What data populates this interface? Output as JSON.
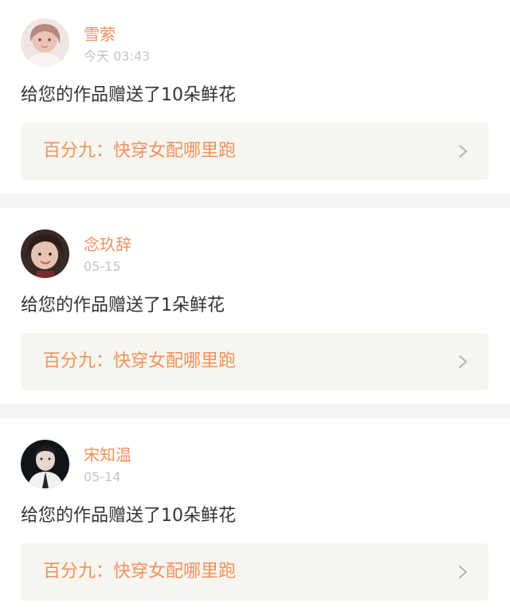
{
  "colors": {
    "accent": "#f0915a",
    "tab_indicator": "#e880a8",
    "timestamp": "#c4c4c4",
    "message_text": "#333333",
    "link_background": "#f6f5f0",
    "separator": "#f5f5f5"
  },
  "gifts": [
    {
      "user_name": "雪萦",
      "time": "今天 03:43",
      "message": "给您的作品赠送了10朵鲜花",
      "book_title": "百分九：快穿女配哪里跑",
      "chevron_icon": "chevron-right-icon"
    },
    {
      "user_name": "念玖辞",
      "time": "05-15",
      "message": "给您的作品赠送了1朵鲜花",
      "book_title": "百分九：快穿女配哪里跑",
      "chevron_icon": "chevron-right-icon"
    },
    {
      "user_name": "宋知温",
      "time": "05-14",
      "message": "给您的作品赠送了10朵鲜花",
      "book_title": "百分九：快穿女配哪里跑",
      "chevron_icon": "chevron-right-icon"
    }
  ]
}
